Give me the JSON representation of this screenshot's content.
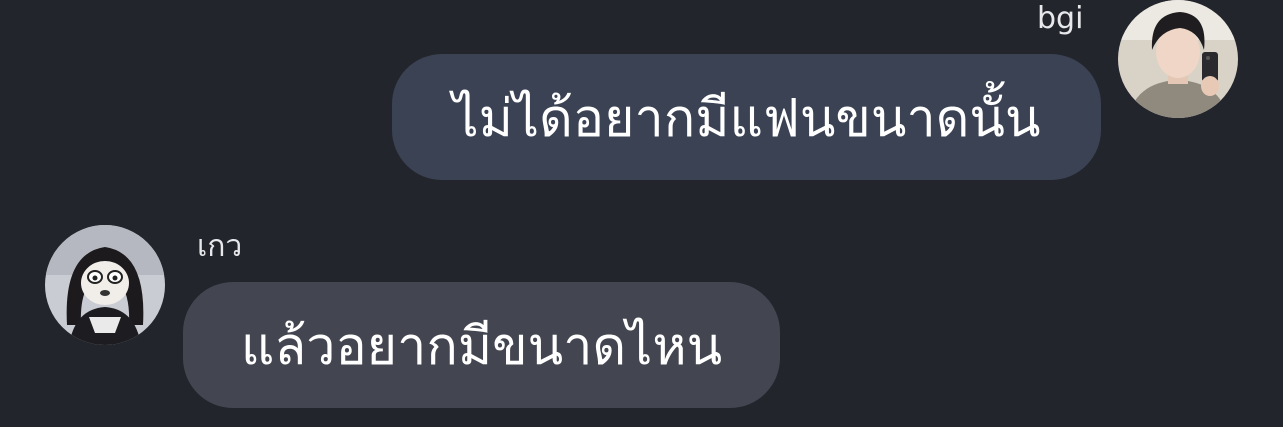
{
  "messages": [
    {
      "sender": "bgi",
      "direction": "outgoing",
      "text": "ไม่ได้อยากมีแฟนขนาดนั้น",
      "avatar_icon": "user-photo-avatar"
    },
    {
      "sender": "เกว",
      "direction": "incoming",
      "text": "แล้วอยากมีขนาดไหน",
      "avatar_icon": "user-photo-avatar"
    }
  ],
  "colors": {
    "background": "#23252d",
    "outgoing_bubble": "#3b4253",
    "incoming_bubble": "#434650",
    "text": "#ffffff"
  }
}
